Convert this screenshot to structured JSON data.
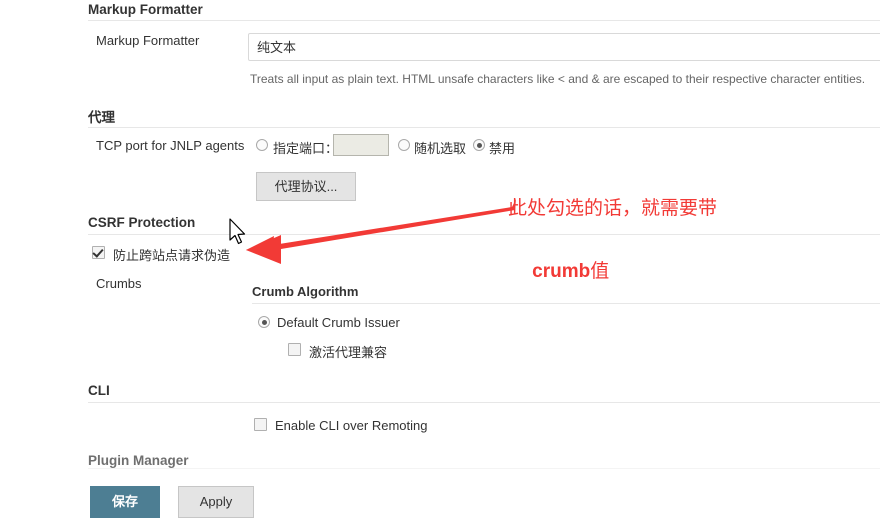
{
  "sections": {
    "markup_formatter": {
      "heading": "Markup Formatter",
      "field_label": "Markup Formatter",
      "select_value": "纯文本",
      "description": "Treats all input as plain text. HTML unsafe characters like < and & are escaped to their respective character entities."
    },
    "proxy": {
      "heading": "代理",
      "field_label": "TCP port for JNLP agents",
      "options": [
        {
          "label": "指定端口：",
          "selected": false
        },
        {
          "label": "随机选取",
          "selected": false
        },
        {
          "label": "禁用",
          "selected": true
        }
      ],
      "port_value": "",
      "button_label": "代理协议..."
    },
    "csrf": {
      "heading": "CSRF Protection",
      "checkbox_label": "防止跨站点请求伪造",
      "checkbox_checked": true,
      "crumbs_label": "Crumbs",
      "crumb_algorithm_heading": "Crumb Algorithm",
      "crumb_issuer_label": "Default Crumb Issuer",
      "crumb_issuer_selected": true,
      "proxy_compat_label": "激活代理兼容",
      "proxy_compat_checked": false
    },
    "cli": {
      "heading": "CLI",
      "checkbox_label": "Enable CLI over Remoting",
      "checkbox_checked": false
    },
    "plugin_manager": {
      "heading": "Plugin Manager"
    }
  },
  "footer": {
    "save_label": "保存",
    "apply_label": "Apply"
  },
  "annotation": {
    "line1": "此处勾选的话，就需要带",
    "line2_latin": "crumb",
    "line2_cjk": "值",
    "color": "#f23a36"
  },
  "colors": {
    "primary_button": "#4d7e93",
    "rule": "#e7e7e7",
    "text": "#333333",
    "muted_text": "#666666",
    "annotation_red": "#f23a36"
  }
}
